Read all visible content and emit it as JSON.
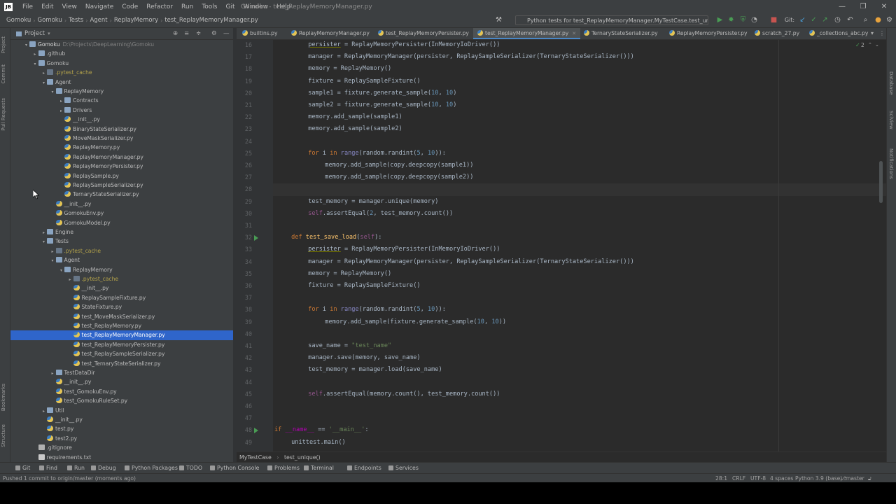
{
  "window": {
    "title": "Gomoku - test_ReplayMemoryManager.py",
    "logo": "JB"
  },
  "menu": [
    "File",
    "Edit",
    "View",
    "Navigate",
    "Code",
    "Refactor",
    "Run",
    "Tools",
    "Git",
    "Window",
    "Help"
  ],
  "breadcrumbs": [
    "Gomoku",
    "Gomoku",
    "Tests",
    "Agent",
    "ReplayMemory",
    "test_ReplayMemoryManager.py"
  ],
  "run_config": "Python tests for test_ReplayMemoryManager.MyTestCase.test_unique",
  "toolbar": {
    "git_label": "Git:"
  },
  "project_panel": {
    "title": "Project",
    "tree": [
      {
        "depth": 0,
        "arrow": "▾",
        "icon": "root",
        "label": "Gomoku",
        "path": "D:\\Projects\\DeepLearning\\Gomoku",
        "style": "root"
      },
      {
        "depth": 1,
        "arrow": "▸",
        "icon": "folder",
        "label": ".github",
        "style": ""
      },
      {
        "depth": 1,
        "arrow": "▾",
        "icon": "folder",
        "label": "Gomoku",
        "style": ""
      },
      {
        "depth": 2,
        "arrow": "▸",
        "icon": "cache",
        "label": ".pytest_cache",
        "style": "yel"
      },
      {
        "depth": 2,
        "arrow": "▾",
        "icon": "folder",
        "label": "Agent",
        "style": ""
      },
      {
        "depth": 3,
        "arrow": "▾",
        "icon": "folder",
        "label": "ReplayMemory",
        "style": ""
      },
      {
        "depth": 4,
        "arrow": "▸",
        "icon": "folder",
        "label": "Contracts",
        "style": ""
      },
      {
        "depth": 4,
        "arrow": "▸",
        "icon": "folder",
        "label": "Drivers",
        "style": ""
      },
      {
        "depth": 4,
        "arrow": "",
        "icon": "py",
        "label": "__init__.py",
        "style": ""
      },
      {
        "depth": 4,
        "arrow": "",
        "icon": "py",
        "label": "BinaryStateSerializer.py",
        "style": ""
      },
      {
        "depth": 4,
        "arrow": "",
        "icon": "py",
        "label": "MoveMaskSerializer.py",
        "style": ""
      },
      {
        "depth": 4,
        "arrow": "",
        "icon": "py",
        "label": "ReplayMemory.py",
        "style": ""
      },
      {
        "depth": 4,
        "arrow": "",
        "icon": "py",
        "label": "ReplayMemoryManager.py",
        "style": ""
      },
      {
        "depth": 4,
        "arrow": "",
        "icon": "py",
        "label": "ReplayMemoryPersister.py",
        "style": ""
      },
      {
        "depth": 4,
        "arrow": "",
        "icon": "py",
        "label": "ReplaySample.py",
        "style": ""
      },
      {
        "depth": 4,
        "arrow": "",
        "icon": "py",
        "label": "ReplaySampleSerializer.py",
        "style": ""
      },
      {
        "depth": 4,
        "arrow": "",
        "icon": "py",
        "label": "TernaryStateSerializer.py",
        "style": ""
      },
      {
        "depth": 3,
        "arrow": "",
        "icon": "py",
        "label": "__init__.py",
        "style": ""
      },
      {
        "depth": 3,
        "arrow": "",
        "icon": "py",
        "label": "GomokuEnv.py",
        "style": ""
      },
      {
        "depth": 3,
        "arrow": "",
        "icon": "py",
        "label": "GomokuModel.py",
        "style": ""
      },
      {
        "depth": 2,
        "arrow": "▸",
        "icon": "folder",
        "label": "Engine",
        "style": ""
      },
      {
        "depth": 2,
        "arrow": "▾",
        "icon": "folder",
        "label": "Tests",
        "style": ""
      },
      {
        "depth": 3,
        "arrow": "▸",
        "icon": "cache",
        "label": ".pytest_cache",
        "style": "yel"
      },
      {
        "depth": 3,
        "arrow": "▾",
        "icon": "folder",
        "label": "Agent",
        "style": ""
      },
      {
        "depth": 4,
        "arrow": "▾",
        "icon": "folder",
        "label": "ReplayMemory",
        "style": ""
      },
      {
        "depth": 5,
        "arrow": "▸",
        "icon": "cache",
        "label": ".pytest_cache",
        "style": "yel"
      },
      {
        "depth": 5,
        "arrow": "",
        "icon": "py",
        "label": "__init__.py",
        "style": ""
      },
      {
        "depth": 5,
        "arrow": "",
        "icon": "py",
        "label": "ReplaySampleFixture.py",
        "style": ""
      },
      {
        "depth": 5,
        "arrow": "",
        "icon": "py",
        "label": "StateFixture.py",
        "style": ""
      },
      {
        "depth": 5,
        "arrow": "",
        "icon": "py",
        "label": "test_MoveMaskSerializer.py",
        "style": ""
      },
      {
        "depth": 5,
        "arrow": "",
        "icon": "py",
        "label": "test_ReplayMemory.py",
        "style": ""
      },
      {
        "depth": 5,
        "arrow": "",
        "icon": "py",
        "label": "test_ReplayMemoryManager.py",
        "style": "",
        "selected": true
      },
      {
        "depth": 5,
        "arrow": "",
        "icon": "py",
        "label": "test_ReplayMemoryPersister.py",
        "style": ""
      },
      {
        "depth": 5,
        "arrow": "",
        "icon": "py",
        "label": "test_ReplaySampleSerializer.py",
        "style": ""
      },
      {
        "depth": 5,
        "arrow": "",
        "icon": "py",
        "label": "test_TernaryStateSerializer.py",
        "style": ""
      },
      {
        "depth": 3,
        "arrow": "▸",
        "icon": "folder",
        "label": "TestDataDir",
        "style": ""
      },
      {
        "depth": 3,
        "arrow": "",
        "icon": "py",
        "label": "__init__.py",
        "style": ""
      },
      {
        "depth": 3,
        "arrow": "",
        "icon": "py",
        "label": "test_GomokuEnv.py",
        "style": ""
      },
      {
        "depth": 3,
        "arrow": "",
        "icon": "py",
        "label": "test_GomokuRuleSet.py",
        "style": ""
      },
      {
        "depth": 2,
        "arrow": "▸",
        "icon": "folder",
        "label": "Util",
        "style": ""
      },
      {
        "depth": 2,
        "arrow": "",
        "icon": "py",
        "label": "__init__.py",
        "style": ""
      },
      {
        "depth": 2,
        "arrow": "",
        "icon": "py",
        "label": "test.py",
        "style": ""
      },
      {
        "depth": 2,
        "arrow": "",
        "icon": "py",
        "label": "test2.py",
        "style": ""
      },
      {
        "depth": 1,
        "arrow": "",
        "icon": "git",
        "label": ".gitignore",
        "style": ""
      },
      {
        "depth": 1,
        "arrow": "",
        "icon": "txt",
        "label": "requirements.txt",
        "style": ""
      }
    ]
  },
  "tabs": [
    {
      "label": "builtins.py",
      "active": false
    },
    {
      "label": "ReplayMemoryManager.py",
      "active": false
    },
    {
      "label": "test_ReplayMemoryPersister.py",
      "active": false
    },
    {
      "label": "test_ReplayMemoryManager.py",
      "active": true
    },
    {
      "label": "TernaryStateSerializer.py",
      "active": false
    },
    {
      "label": "ReplayMemoryPersister.py",
      "active": false
    },
    {
      "label": "scratch_27.py",
      "active": false
    },
    {
      "label": "_collections_abc.py",
      "active": false
    }
  ],
  "inspection_badge": "2",
  "editor": {
    "current_line": 28,
    "lines": [
      {
        "n": "16",
        "run": false,
        "indent": 2,
        "tokens": [
          [
            "persister",
            "ul"
          ],
          [
            " = ReplayMemoryPersister(InMemoryIoDriver())",
            ""
          ]
        ]
      },
      {
        "n": "17",
        "run": false,
        "indent": 2,
        "tokens": [
          [
            "manager = ReplayMemoryManager(persister, ReplaySampleSerializer(TernaryStateSerializer()))",
            ""
          ]
        ]
      },
      {
        "n": "18",
        "run": false,
        "indent": 2,
        "tokens": [
          [
            "memory = ReplayMemory()",
            ""
          ]
        ]
      },
      {
        "n": "19",
        "run": false,
        "indent": 2,
        "tokens": [
          [
            "fixture = ReplaySampleFixture()",
            ""
          ]
        ]
      },
      {
        "n": "20",
        "run": false,
        "indent": 2,
        "tokens": [
          [
            "sample1 = fixture.generate_sample(",
            ""
          ],
          [
            "10",
            "num"
          ],
          [
            ", ",
            ""
          ],
          [
            "10",
            "num"
          ],
          [
            ")",
            ""
          ]
        ]
      },
      {
        "n": "21",
        "run": false,
        "indent": 2,
        "tokens": [
          [
            "sample2 = fixture.generate_sample(",
            ""
          ],
          [
            "10",
            "num"
          ],
          [
            ", ",
            ""
          ],
          [
            "10",
            "num"
          ],
          [
            ")",
            ""
          ]
        ]
      },
      {
        "n": "22",
        "run": false,
        "indent": 2,
        "tokens": [
          [
            "memory.add_sample(sample1)",
            ""
          ]
        ]
      },
      {
        "n": "23",
        "run": false,
        "indent": 2,
        "tokens": [
          [
            "memory.add_sample(sample2)",
            ""
          ]
        ]
      },
      {
        "n": "24",
        "run": false,
        "indent": 0,
        "tokens": []
      },
      {
        "n": "25",
        "run": false,
        "indent": 2,
        "tokens": [
          [
            "for ",
            "kw"
          ],
          [
            "i ",
            ""
          ],
          [
            "in ",
            "kw"
          ],
          [
            "range",
            "bi"
          ],
          [
            "(random.randint(",
            ""
          ],
          [
            "5",
            "num"
          ],
          [
            ", ",
            ""
          ],
          [
            "10",
            "num"
          ],
          [
            ")):",
            ""
          ]
        ]
      },
      {
        "n": "26",
        "run": false,
        "indent": 3,
        "tokens": [
          [
            "memory.add_sample(copy.deepcopy(sample1))",
            ""
          ]
        ]
      },
      {
        "n": "27",
        "run": false,
        "indent": 3,
        "tokens": [
          [
            "memory.add_sample(copy.deepcopy(sample2))",
            ""
          ]
        ]
      },
      {
        "n": "28",
        "run": false,
        "indent": 0,
        "tokens": []
      },
      {
        "n": "29",
        "run": false,
        "indent": 2,
        "tokens": [
          [
            "test_memory = manager.unique(memory)",
            ""
          ]
        ]
      },
      {
        "n": "30",
        "run": false,
        "indent": 2,
        "tokens": [
          [
            "self",
            "selfk"
          ],
          [
            ".assertEqual(",
            ""
          ],
          [
            "2",
            "num"
          ],
          [
            ", test_memory.count())",
            ""
          ]
        ]
      },
      {
        "n": "31",
        "run": false,
        "indent": 0,
        "tokens": []
      },
      {
        "n": "32",
        "run": true,
        "indent": 1,
        "tokens": [
          [
            "def ",
            "kw"
          ],
          [
            "test_save_load",
            "fn"
          ],
          [
            "(",
            ""
          ],
          [
            "self",
            "selfk"
          ],
          [
            "):",
            ""
          ]
        ]
      },
      {
        "n": "33",
        "run": false,
        "indent": 2,
        "tokens": [
          [
            "persister",
            "ul"
          ],
          [
            " = ReplayMemoryPersister(InMemoryIoDriver())",
            ""
          ]
        ]
      },
      {
        "n": "34",
        "run": false,
        "indent": 2,
        "tokens": [
          [
            "manager = ReplayMemoryManager(persister, ReplaySampleSerializer(TernaryStateSerializer()))",
            ""
          ]
        ]
      },
      {
        "n": "35",
        "run": false,
        "indent": 2,
        "tokens": [
          [
            "memory = ReplayMemory()",
            ""
          ]
        ]
      },
      {
        "n": "36",
        "run": false,
        "indent": 2,
        "tokens": [
          [
            "fixture = ReplaySampleFixture()",
            ""
          ]
        ]
      },
      {
        "n": "37",
        "run": false,
        "indent": 0,
        "tokens": []
      },
      {
        "n": "38",
        "run": false,
        "indent": 2,
        "tokens": [
          [
            "for ",
            "kw"
          ],
          [
            "i ",
            ""
          ],
          [
            "in ",
            "kw"
          ],
          [
            "range",
            "bi"
          ],
          [
            "(random.randint(",
            ""
          ],
          [
            "5",
            "num"
          ],
          [
            ", ",
            ""
          ],
          [
            "10",
            "num"
          ],
          [
            ")):",
            ""
          ]
        ]
      },
      {
        "n": "39",
        "run": false,
        "indent": 3,
        "tokens": [
          [
            "memory.add_sample(fixture.generate_sample(",
            ""
          ],
          [
            "10",
            "num"
          ],
          [
            ", ",
            ""
          ],
          [
            "10",
            "num"
          ],
          [
            "))",
            ""
          ]
        ]
      },
      {
        "n": "40",
        "run": false,
        "indent": 0,
        "tokens": []
      },
      {
        "n": "41",
        "run": false,
        "indent": 2,
        "tokens": [
          [
            "save_name = ",
            ""
          ],
          [
            "\"test_name\"",
            "str"
          ]
        ]
      },
      {
        "n": "42",
        "run": false,
        "indent": 2,
        "tokens": [
          [
            "manager.save(memory, save_name)",
            ""
          ]
        ]
      },
      {
        "n": "43",
        "run": false,
        "indent": 2,
        "tokens": [
          [
            "test_memory = manager.load(save_name)",
            ""
          ]
        ]
      },
      {
        "n": "44",
        "run": false,
        "indent": 0,
        "tokens": []
      },
      {
        "n": "45",
        "run": false,
        "indent": 2,
        "tokens": [
          [
            "self",
            "selfk"
          ],
          [
            ".assertEqual(memory.count(), test_memory.count())",
            ""
          ]
        ]
      },
      {
        "n": "46",
        "run": false,
        "indent": 0,
        "tokens": []
      },
      {
        "n": "47",
        "run": false,
        "indent": 0,
        "tokens": []
      },
      {
        "n": "48",
        "run": true,
        "indent": 0,
        "tokens": [
          [
            "if ",
            "kw"
          ],
          [
            "__name__",
            "dunder"
          ],
          [
            " == ",
            ""
          ],
          [
            "'__main__'",
            "str"
          ],
          [
            ":",
            ""
          ]
        ]
      },
      {
        "n": "49",
        "run": false,
        "indent": 1,
        "tokens": [
          [
            "unittest.main()",
            ""
          ]
        ]
      }
    ]
  },
  "editor_breadcrumb": [
    "MyTestCase",
    "test_unique()"
  ],
  "left_strip": [
    "Project",
    "Commit",
    "Pull Requests",
    "Bookmarks",
    "Structure"
  ],
  "right_strip": [
    "Database",
    "SciView",
    "Notifications"
  ],
  "tool_windows": [
    "Git",
    "Find",
    "Run",
    "Debug",
    "Python Packages",
    "TODO",
    "Python Console",
    "Problems",
    "Terminal",
    "Endpoints",
    "Services"
  ],
  "status": {
    "message": "Pushed 1 commit to origin/master (moments ago)",
    "position": "28:1",
    "line_sep": "CRLF",
    "encoding": "UTF-8",
    "indent": "4 spaces",
    "interpreter": "Python 3.9 (base)",
    "branch": "master"
  },
  "colors": {
    "accent": "#2f65ca",
    "bg": "#2b2b2b",
    "panel": "#3c3f41",
    "run": "#499c54"
  }
}
